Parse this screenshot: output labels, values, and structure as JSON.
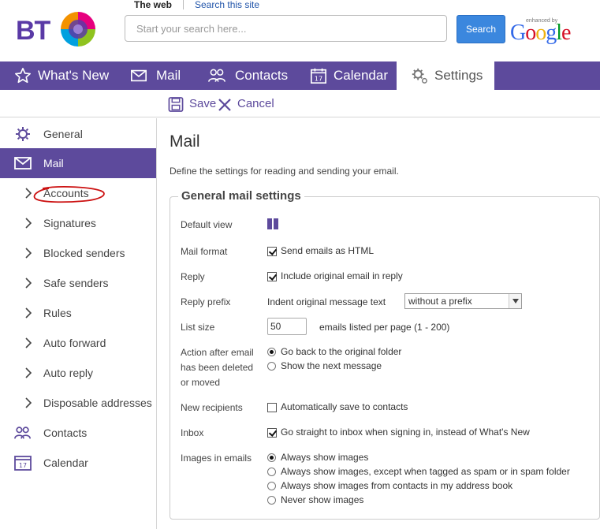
{
  "header": {
    "logo_text": "BT",
    "search_tabs": {
      "web": "The web",
      "site": "Search this site"
    },
    "search": {
      "placeholder": "Start your search here...",
      "value": ""
    },
    "search_button": "Search",
    "google": {
      "enhanced_by": "enhanced by",
      "word": "Google"
    }
  },
  "nav": {
    "items": [
      {
        "label": "What's New",
        "icon": "star-icon"
      },
      {
        "label": "Mail",
        "icon": "envelope-icon"
      },
      {
        "label": "Contacts",
        "icon": "contacts-icon"
      },
      {
        "label": "Calendar",
        "icon": "calendar-icon"
      },
      {
        "label": "Settings",
        "icon": "gear-icon",
        "active": true
      }
    ],
    "calendar_day": "17"
  },
  "toolbar": {
    "save_label": "Save",
    "cancel_label": "Cancel"
  },
  "sidebar": {
    "general": "General",
    "mail": "Mail",
    "sub_items": [
      "Accounts",
      "Signatures",
      "Blocked senders",
      "Safe senders",
      "Rules",
      "Auto forward",
      "Auto reply",
      "Disposable addresses"
    ],
    "contacts": "Contacts",
    "calendar": "Calendar"
  },
  "main": {
    "title": "Mail",
    "description": "Define the settings for reading and sending your email.",
    "section_title": "General mail settings",
    "labels": {
      "default_view": "Default view",
      "mail_format": "Mail format",
      "reply": "Reply",
      "reply_prefix": "Reply prefix",
      "list_size": "List size",
      "after_delete_1": "Action after email",
      "after_delete_2": "has been deleted",
      "after_delete_3": "or moved",
      "new_recipients": "New recipients",
      "inbox": "Inbox",
      "images": "Images in emails"
    },
    "mail_format_option": "Send emails as HTML",
    "reply_option": "Include original email in reply",
    "reply_prefix_text": "Indent original message text",
    "reply_prefix_value": "without a prefix",
    "list_size_value": "50",
    "list_size_suffix": "emails listed per page (1 - 200)",
    "after_delete_options": [
      "Go back to the original folder",
      "Show the next message"
    ],
    "after_delete_selected": 0,
    "new_recipients_option": "Automatically save to contacts",
    "inbox_option": "Go straight to inbox when signing in, instead of What's New",
    "image_options": [
      "Always show images",
      "Always show images, except when tagged as spam or in spam folder",
      "Always show images from contacts in my address book",
      "Never show images"
    ],
    "image_selected": 0,
    "checkbox_states": {
      "mail_format": true,
      "reply": true,
      "new_recipients": false,
      "inbox": true
    }
  },
  "colors": {
    "brand_purple": "#5d4a9c",
    "search_blue": "#3b87de",
    "annotation_red": "#cc1111"
  }
}
